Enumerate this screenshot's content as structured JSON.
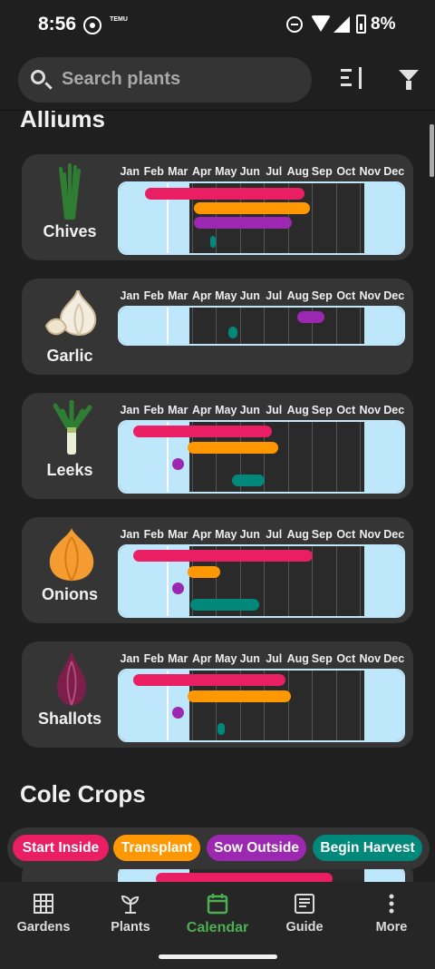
{
  "status_bar": {
    "time": "8:56",
    "battery": "8%",
    "temu_label": "TEMU"
  },
  "search": {
    "placeholder": "Search plants"
  },
  "sections": [
    {
      "title": "Alliums"
    },
    {
      "title": "Cole Crops"
    }
  ],
  "months": [
    "Jan",
    "Feb",
    "Mar",
    "Apr",
    "May",
    "Jun",
    "Jul",
    "Aug",
    "Sep",
    "Oct",
    "Nov",
    "Dec"
  ],
  "plants": [
    {
      "name": "Chives",
      "icon": "chives-icon"
    },
    {
      "name": "Garlic",
      "icon": "garlic-icon"
    },
    {
      "name": "Leeks",
      "icon": "leek-icon"
    },
    {
      "name": "Onions",
      "icon": "onion-icon"
    },
    {
      "name": "Shallots",
      "icon": "shallot-icon"
    }
  ],
  "legend": [
    {
      "label": "Start Inside",
      "color": "#e91e63"
    },
    {
      "label": "Transplant",
      "color": "#ff9800"
    },
    {
      "label": "Sow Outside",
      "color": "#9c27b0"
    },
    {
      "label": "Begin Harvest",
      "color": "#00897b"
    }
  ],
  "nav": [
    {
      "label": "Gardens",
      "icon": "grid-icon"
    },
    {
      "label": "Plants",
      "icon": "sprout-icon"
    },
    {
      "label": "Calendar",
      "icon": "calendar-icon",
      "active": true
    },
    {
      "label": "Guide",
      "icon": "guide-icon"
    },
    {
      "label": "More",
      "icon": "more-vert-icon"
    }
  ]
}
